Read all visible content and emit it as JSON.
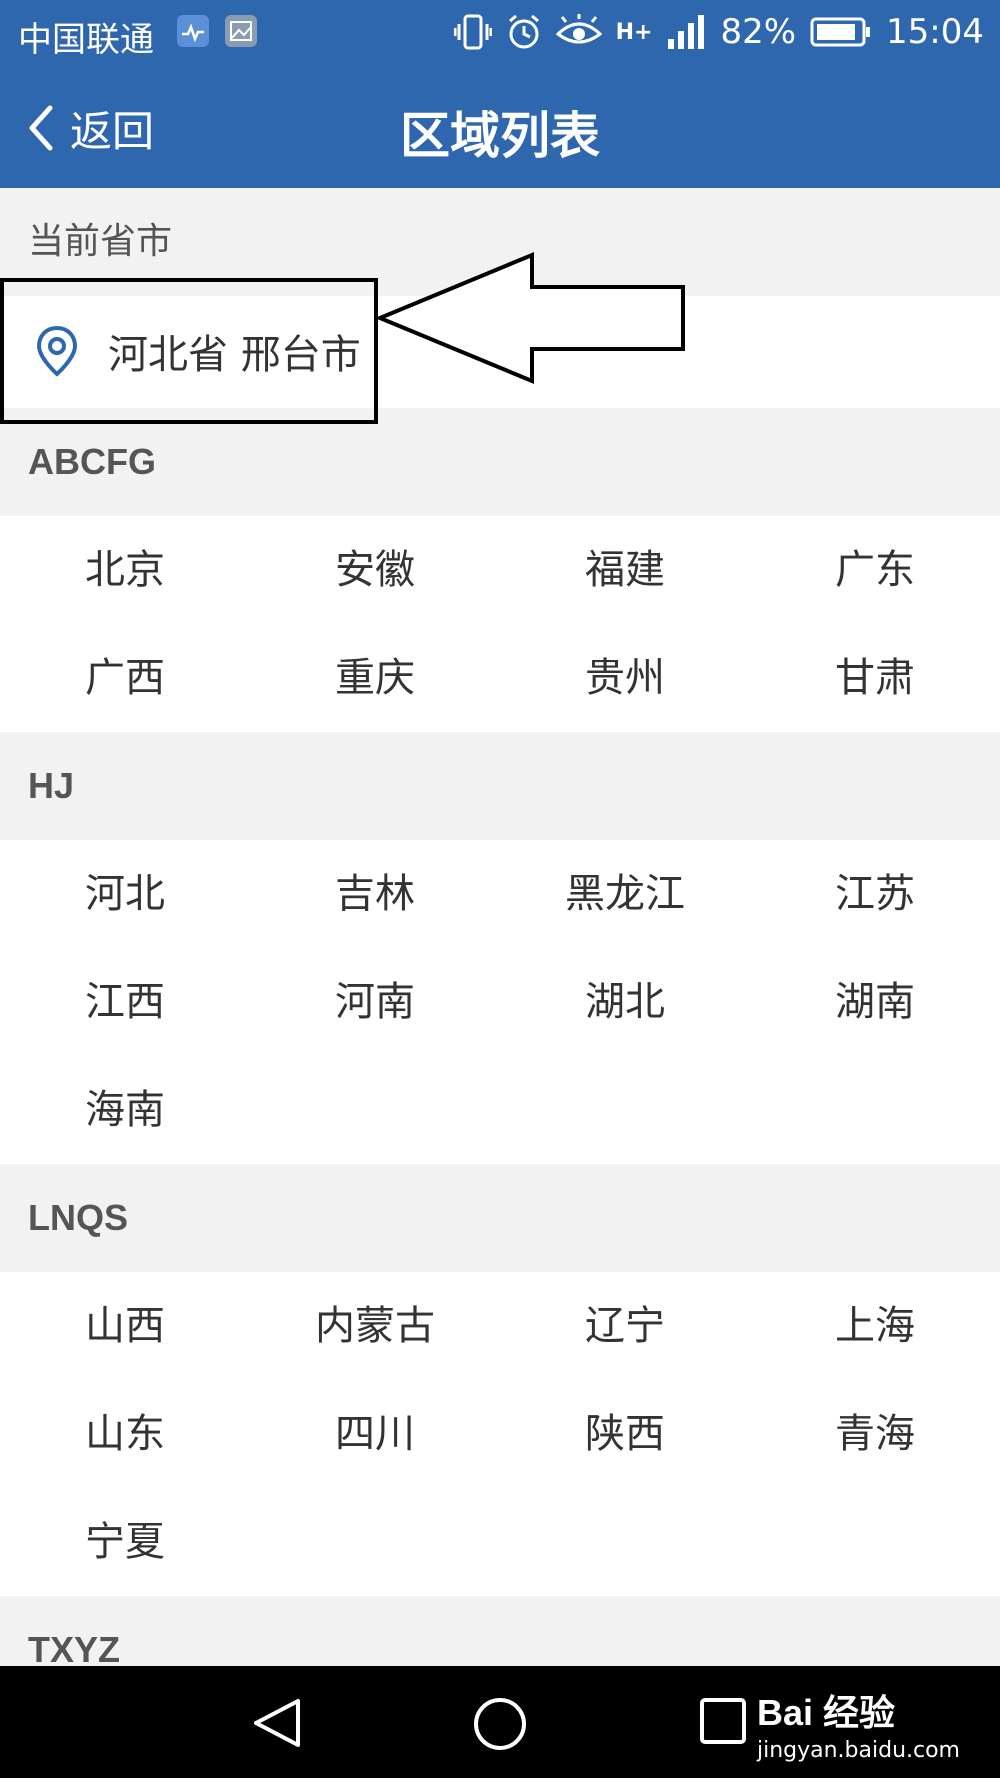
{
  "status_bar": {
    "carrier": "中国联通",
    "battery": "82%",
    "time": "15:04",
    "network_type": "H+"
  },
  "app_bar": {
    "back_label": "返回",
    "title": "区域列表"
  },
  "current_section": {
    "header": "当前省市",
    "location": "河北省 邢台市"
  },
  "groups": [
    {
      "header": "ABCFG",
      "items": [
        "北京",
        "安徽",
        "福建",
        "广东",
        "广西",
        "重庆",
        "贵州",
        "甘肃"
      ]
    },
    {
      "header": "HJ",
      "items": [
        "河北",
        "吉林",
        "黑龙江",
        "江苏",
        "江西",
        "河南",
        "湖北",
        "湖南",
        "海南"
      ]
    },
    {
      "header": "LNQS",
      "items": [
        "山西",
        "内蒙古",
        "辽宁",
        "上海",
        "山东",
        "四川",
        "陕西",
        "青海",
        "宁夏"
      ]
    },
    {
      "header": "TXYZ",
      "items": []
    }
  ],
  "watermark": {
    "brand": "Bai 经验",
    "url": "jingyan.baidu.com"
  },
  "colors": {
    "primary": "#2e67ad",
    "background": "#f2f2f2",
    "location_icon": "#2e67ad"
  }
}
